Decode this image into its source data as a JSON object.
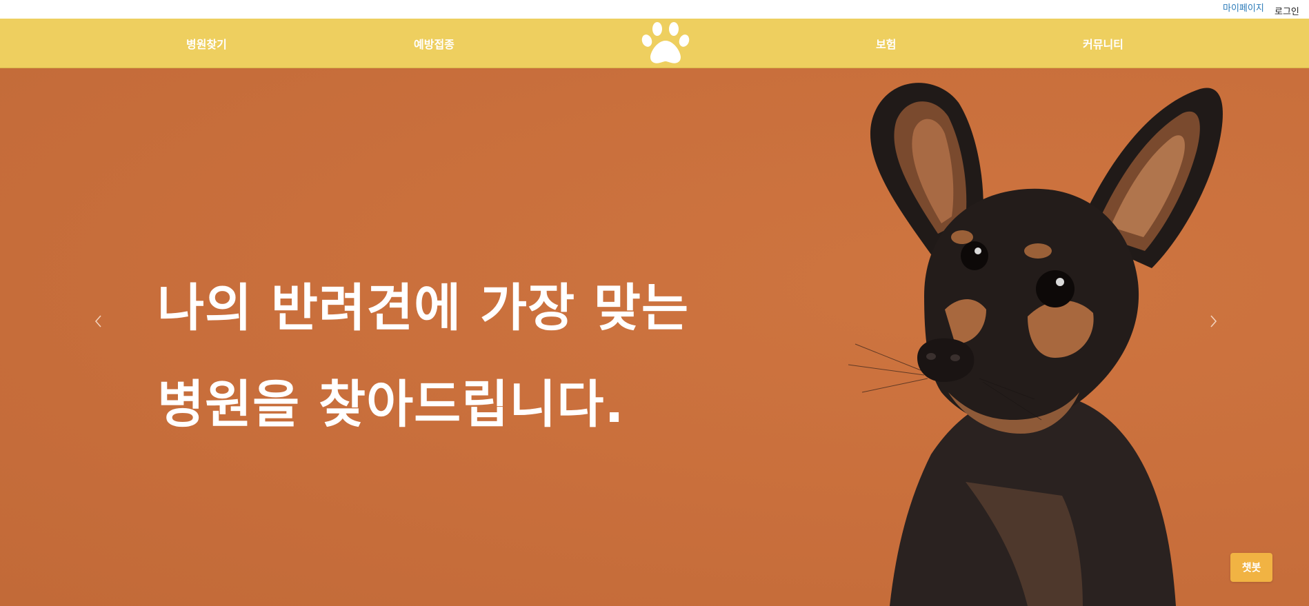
{
  "topbar": {
    "mypage_label": "마이페이지",
    "login_label": "로그인"
  },
  "nav": {
    "items": [
      {
        "label": "병원찾기"
      },
      {
        "label": "예방접종"
      },
      {
        "label": "보험"
      },
      {
        "label": "커뮤니티"
      }
    ],
    "logo_icon": "paw-icon"
  },
  "hero": {
    "headline_line1": "나의 반려견에 가장 맞는",
    "headline_line2": "병원을 찾아드립니다.",
    "prev_icon": "chevron-left-icon",
    "next_icon": "chevron-right-icon",
    "image": "dog-photo"
  },
  "chatbot": {
    "label": "챗봇"
  },
  "colors": {
    "nav_bg": "#eecf5f",
    "hero_bg": "#c8703c",
    "chatbot_bg": "#f1b343",
    "mypage_link": "#2a7ab8"
  }
}
